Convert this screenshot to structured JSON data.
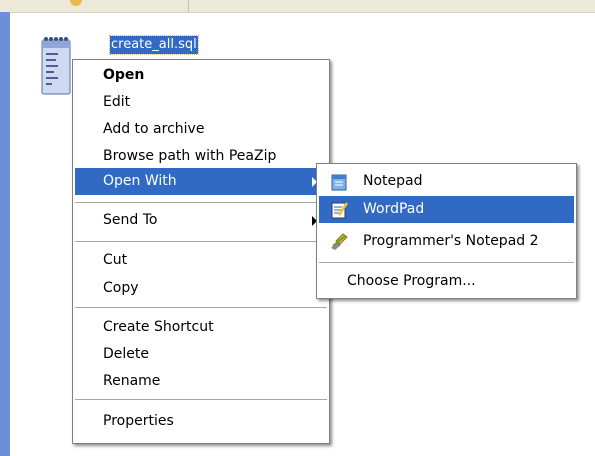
{
  "file": {
    "name": "create_all.sql",
    "icon": "notepad-file-icon"
  },
  "context_menu": {
    "items": [
      {
        "label": "Open",
        "bold": true
      },
      {
        "label": "Edit"
      },
      {
        "label": "Add to archive"
      },
      {
        "label": "Browse path with PeaZip"
      },
      {
        "label": "Open With",
        "submenu": true,
        "highlighted": true
      },
      {
        "label": "Send To",
        "submenu": true
      },
      {
        "label": "Cut"
      },
      {
        "label": "Copy"
      },
      {
        "label": "Create Shortcut"
      },
      {
        "label": "Delete"
      },
      {
        "label": "Rename"
      },
      {
        "label": "Properties"
      }
    ]
  },
  "open_with_menu": {
    "items": [
      {
        "label": "Notepad",
        "icon": "notepad-icon"
      },
      {
        "label": "WordPad",
        "icon": "wordpad-icon",
        "highlighted": true
      },
      {
        "label": "Programmer's Notepad 2",
        "icon": "programmers-notepad-icon"
      },
      {
        "label": "Choose Program..."
      }
    ]
  },
  "colors": {
    "highlight": "#316ac5",
    "taskpane": "#6d8fd9",
    "chrome": "#ece9d8"
  }
}
